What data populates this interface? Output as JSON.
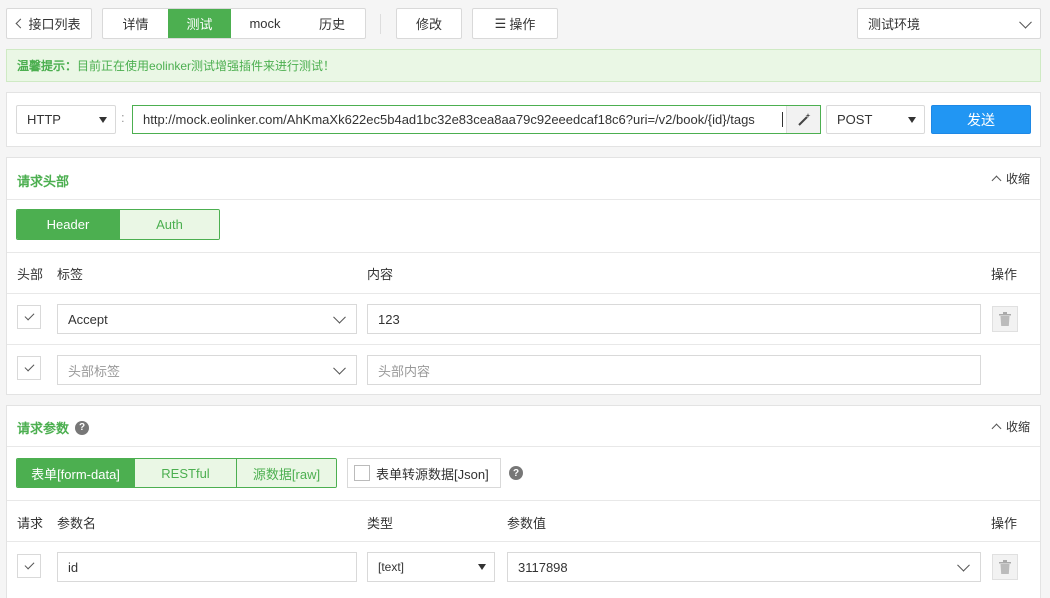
{
  "toolbar": {
    "back_label": "接口列表",
    "tabs": [
      "详情",
      "测试",
      "mock",
      "历史"
    ],
    "edit_label": "修改",
    "ops_label": "操作",
    "env_label": "测试环境"
  },
  "tip": {
    "bold": "温馨提示：",
    "text": "目前正在使用eolinker测试增强插件来进行测试！"
  },
  "request": {
    "protocol": "HTTP",
    "url": "http://mock.eolinker.com/AhKmaXk622ec5b4ad1bc32e83cea8aa79c92eeedcaf18c6?uri=/v2/book/{id}/tags",
    "method": "POST",
    "send_label": "发送"
  },
  "headers_section": {
    "title": "请求头部",
    "collapse_label": "收缩",
    "tabs": [
      "Header",
      "Auth"
    ],
    "columns": [
      "头部",
      "标签",
      "内容",
      "操作"
    ],
    "rows": [
      {
        "label": "Accept",
        "content": "123"
      }
    ],
    "new_row": {
      "label_placeholder": "头部标签",
      "content_placeholder": "头部内容"
    }
  },
  "params_section": {
    "title": "请求参数",
    "collapse_label": "收缩",
    "tabs": [
      "表单[form-data]",
      "RESTful",
      "源数据[raw]"
    ],
    "convert_label": "表单转源数据[Json]",
    "columns": [
      "请求",
      "参数名",
      "类型",
      "参数值",
      "操作"
    ],
    "rows": [
      {
        "name": "id",
        "type": "[text]",
        "value": "3117898"
      }
    ]
  },
  "icons": {
    "help": "?"
  }
}
